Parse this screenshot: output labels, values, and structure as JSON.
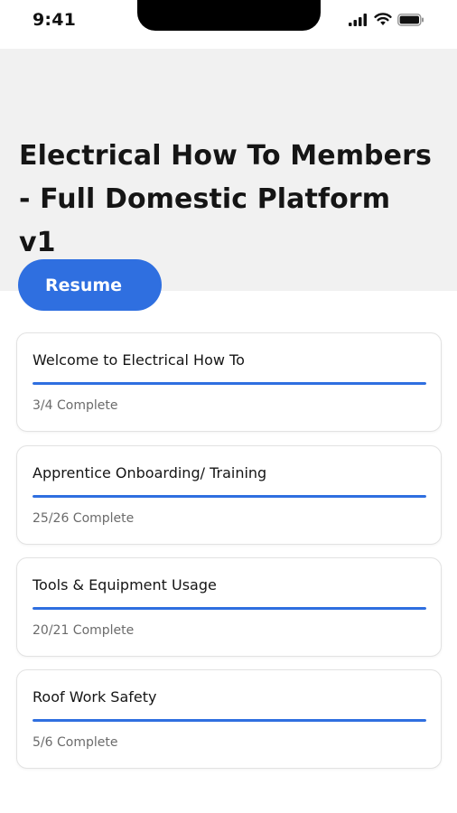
{
  "status_bar": {
    "time": "9:41",
    "icons": [
      "cellular-signal-icon",
      "wifi-icon",
      "battery-icon"
    ]
  },
  "course": {
    "title": "Electrical How To Members - Full Domestic Platform v1"
  },
  "actions": {
    "resume_label": "Resume"
  },
  "colors": {
    "accent": "#2f6fe0",
    "hero_background": "#f1f1f1"
  },
  "modules": [
    {
      "title": "Welcome to Electrical How To",
      "status": "3/4 Complete",
      "progress": 1.0
    },
    {
      "title": "Apprentice Onboarding/ Training",
      "status": "25/26 Complete",
      "progress": 1.0
    },
    {
      "title": "Tools & Equipment Usage",
      "status": "20/21 Complete",
      "progress": 1.0
    },
    {
      "title": "Roof Work Safety",
      "status": "5/6 Complete",
      "progress": 1.0
    }
  ]
}
